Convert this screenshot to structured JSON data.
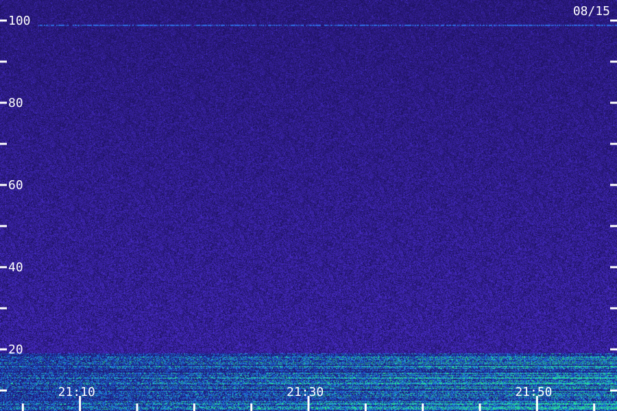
{
  "date_label": "08/15",
  "colors": {
    "background": "#241a6e",
    "noise_low": "#1a1258",
    "noise_high": "#4a30c8",
    "signal_mid": "#1e8cd8",
    "signal_high": "#22e88a",
    "axis": "#ffffff",
    "baseline_line": "#2d6ee8"
  },
  "chart_data": {
    "type": "heatmap",
    "title": "",
    "xlabel": "",
    "ylabel": "",
    "ylim": [
      0,
      100
    ],
    "yticks_labeled": [
      20,
      40,
      60,
      80,
      100
    ],
    "yticks_minor": [
      10,
      30,
      50,
      70,
      90
    ],
    "xlim": [
      "21:03",
      "21:57"
    ],
    "xticks_labeled": [
      "21:10",
      "21:30",
      "21:50"
    ],
    "xticks_minor": [
      "21:05",
      "21:15",
      "21:20",
      "21:25",
      "21:35",
      "21:40",
      "21:45",
      "21:55"
    ],
    "features": [
      {
        "kind": "horizontal_line",
        "y": 99
      },
      {
        "kind": "dense_band",
        "y_from": 0,
        "y_to": 19
      }
    ]
  }
}
